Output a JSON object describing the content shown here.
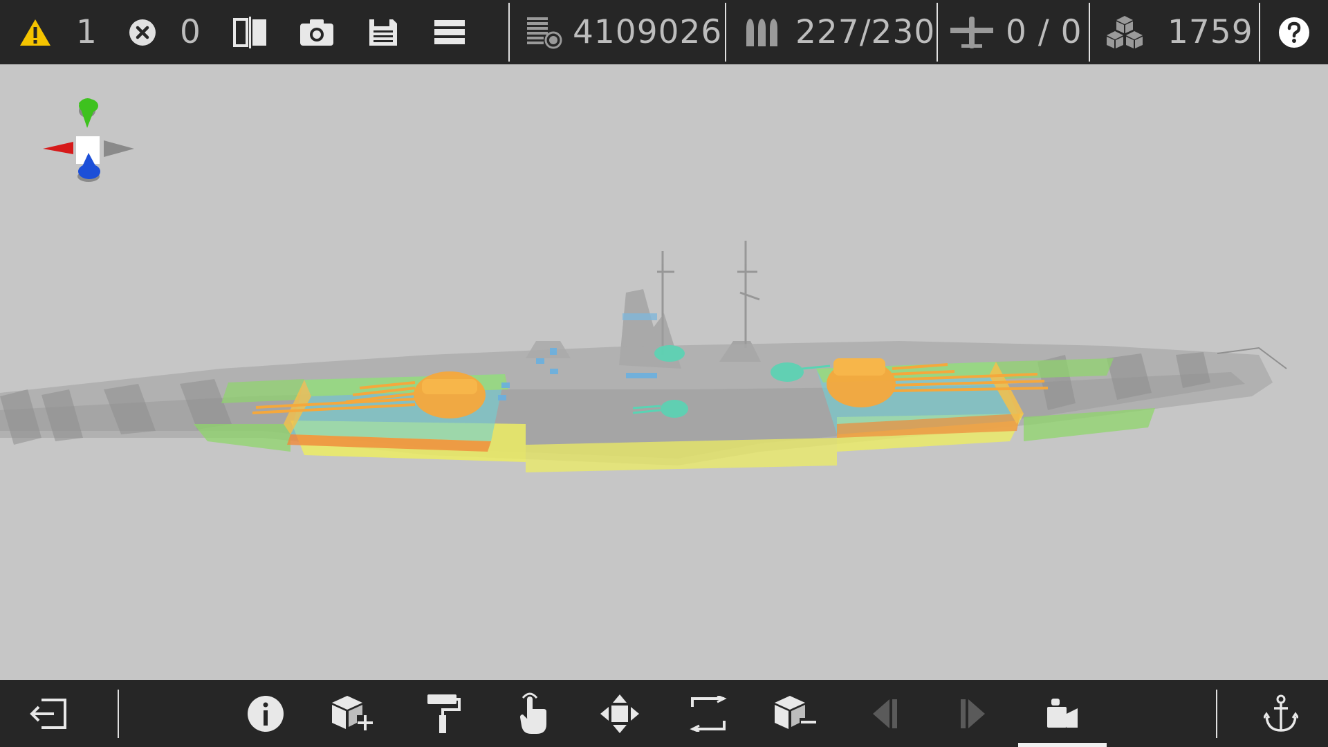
{
  "app": {
    "colors": {
      "toolbar_bg": "#262626",
      "viewport_bg": "#c6c6c6",
      "icon": "#e8e8e8",
      "icon_disabled": "#5a5a5a",
      "warning": "#f5c400",
      "axis_x": "#d61a1a",
      "axis_y": "#3ec21e",
      "axis_z": "#1c4fd8"
    }
  },
  "top_bar": {
    "warnings": {
      "icon": "warning-icon",
      "count": "1"
    },
    "errors": {
      "icon": "error-icon",
      "count": "0"
    },
    "tools": [
      {
        "name": "mirror-icon"
      },
      {
        "name": "camera-icon"
      },
      {
        "name": "save-icon"
      },
      {
        "name": "menu-icon"
      }
    ],
    "stats": {
      "cost": {
        "icon": "cost-icon",
        "value": "4109026"
      },
      "ammo": {
        "icon": "ammo-icon",
        "value": "227/230"
      },
      "aircraft": {
        "icon": "aircraft-icon",
        "value": "0 / 0"
      },
      "blocks": {
        "icon": "blocks-icon",
        "value": "1759"
      }
    },
    "help": {
      "icon": "help-icon"
    }
  },
  "viewport": {
    "orientation_gizmo": {
      "name": "orientation-gizmo"
    },
    "model": {
      "name": "battleship-model"
    }
  },
  "bottom_bar": {
    "tools": [
      {
        "name": "exit-icon",
        "state": "enabled"
      },
      {
        "name": "info-icon",
        "state": "enabled"
      },
      {
        "name": "add-block-icon",
        "state": "enabled"
      },
      {
        "name": "paint-roller-icon",
        "state": "enabled"
      },
      {
        "name": "select-hand-icon",
        "state": "enabled"
      },
      {
        "name": "move-icon",
        "state": "enabled"
      },
      {
        "name": "scale-icon",
        "state": "enabled"
      },
      {
        "name": "remove-block-icon",
        "state": "enabled"
      },
      {
        "name": "previous-icon",
        "state": "disabled"
      },
      {
        "name": "next-icon",
        "state": "disabled"
      },
      {
        "name": "camera-view-icon",
        "state": "active"
      },
      {
        "name": "anchor-icon",
        "state": "enabled"
      }
    ]
  }
}
